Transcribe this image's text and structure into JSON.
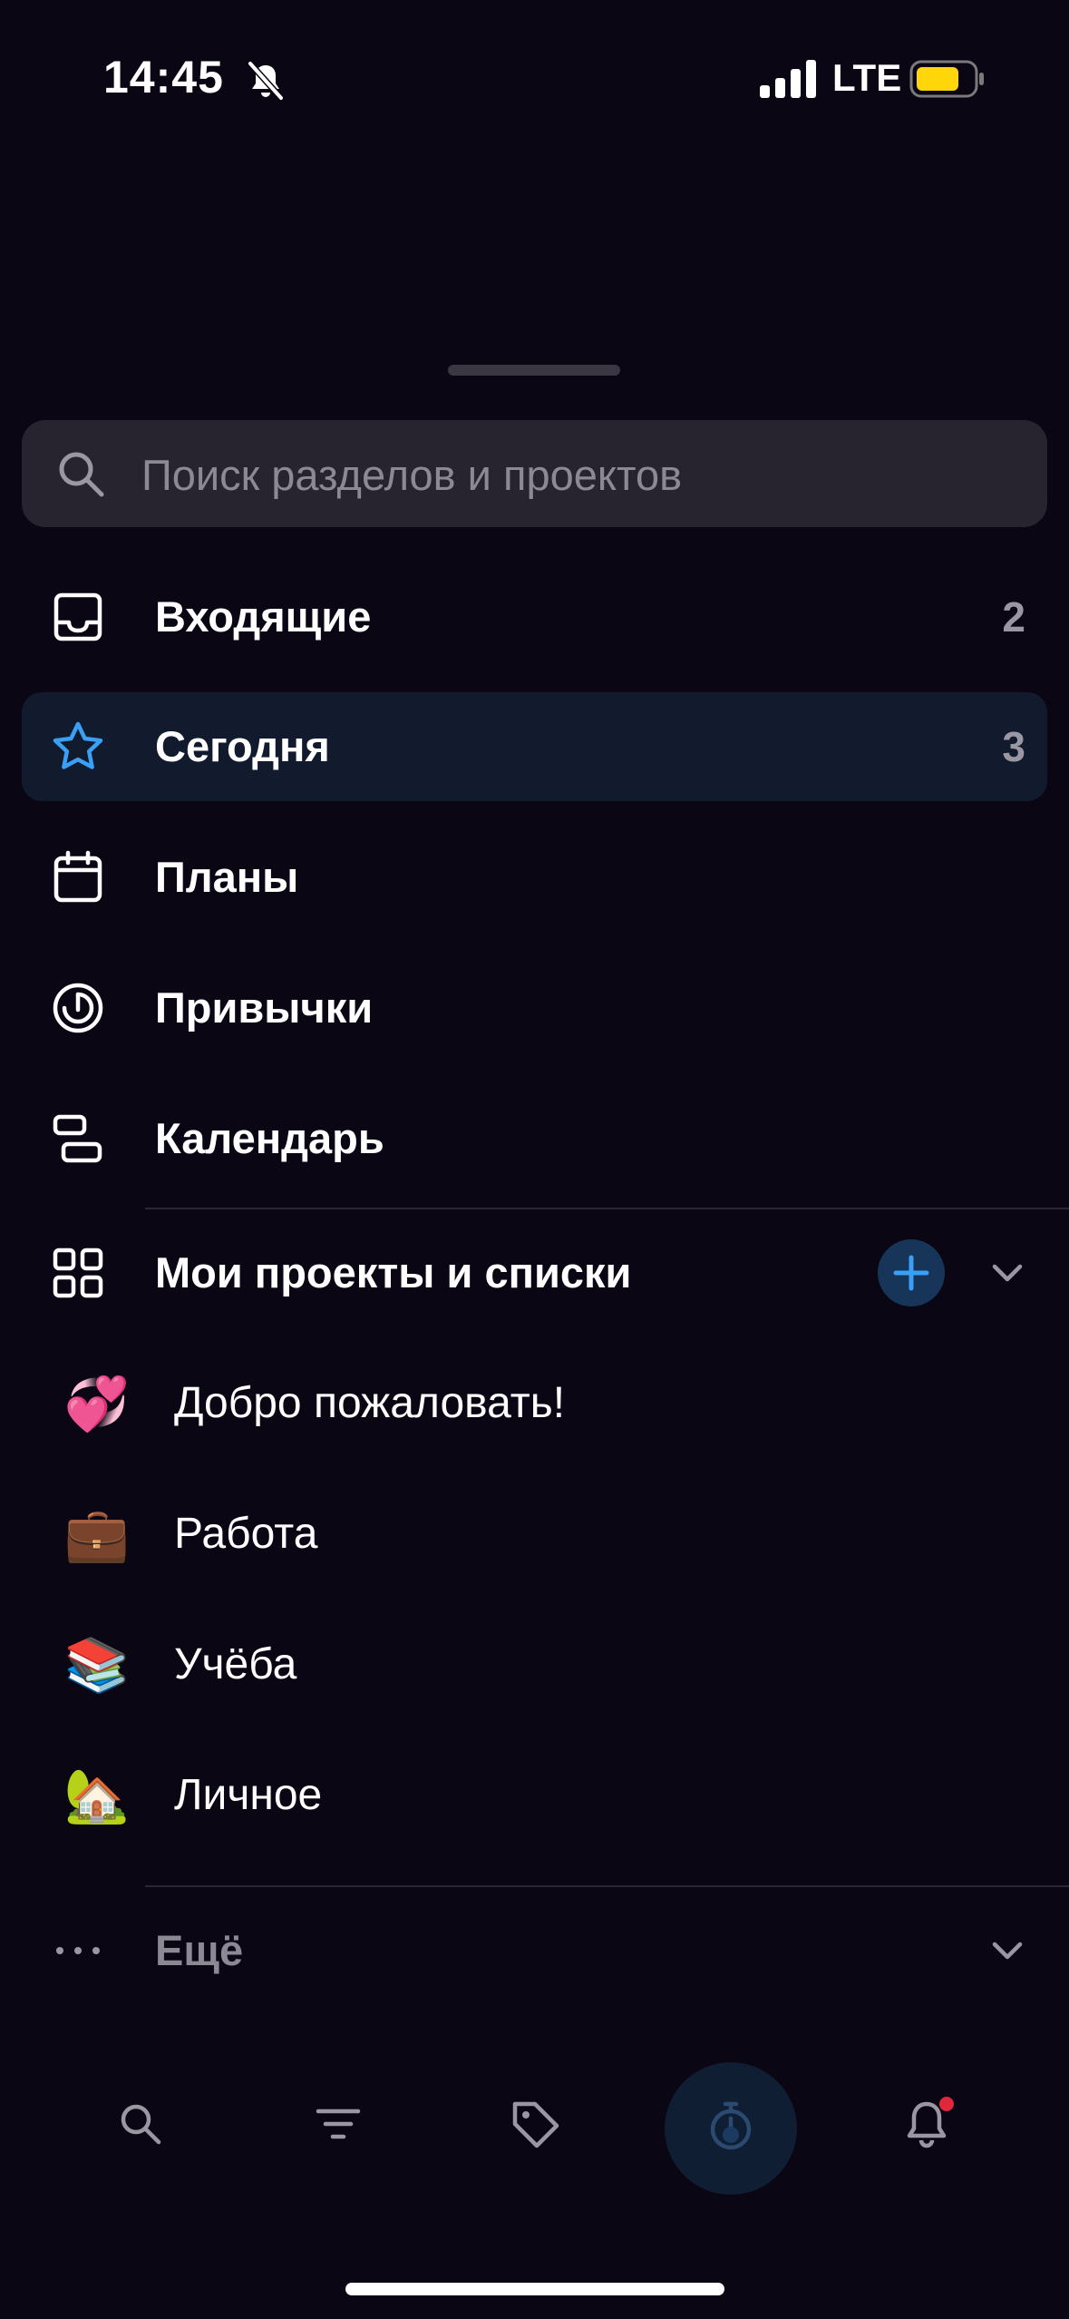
{
  "status_bar": {
    "time": "14:45",
    "network": "LTE",
    "icons": [
      "bell-slash-icon",
      "signal-icon",
      "battery-icon"
    ]
  },
  "search": {
    "placeholder": "Поиск разделов и проектов",
    "icon": "search-icon"
  },
  "sections": [
    {
      "label": "Входящие",
      "count": "2",
      "icon": "inbox-icon"
    },
    {
      "label": "Сегодня",
      "count": "3",
      "icon": "star-icon",
      "active": true
    },
    {
      "label": "Планы",
      "icon": "calendar-icon"
    },
    {
      "label": "Привычки",
      "icon": "habit-target-icon"
    },
    {
      "label": "Календарь",
      "icon": "timeline-icon"
    }
  ],
  "projects_header": {
    "label": "Мои проекты и списки",
    "icon": "grid-icon"
  },
  "projects": [
    {
      "label": "Добро пожаловать!",
      "emoji": "💞"
    },
    {
      "label": "Работа",
      "emoji": "💼"
    },
    {
      "label": "Учёба",
      "emoji": "📚"
    },
    {
      "label": "Личное",
      "emoji": "🏡"
    }
  ],
  "more": {
    "label": "Ещё",
    "icon": "ellipsis-icon"
  },
  "bottom_bar": {
    "tabs": [
      "search-icon",
      "filter-icon",
      "tag-icon",
      "stopwatch-icon",
      "bell-icon"
    ]
  },
  "colors": {
    "background": "#0a0614",
    "active_row": "#121a2e",
    "accent_blue": "#3aa0f5",
    "battery": "#ffd60a",
    "notification": "#e0283c"
  }
}
